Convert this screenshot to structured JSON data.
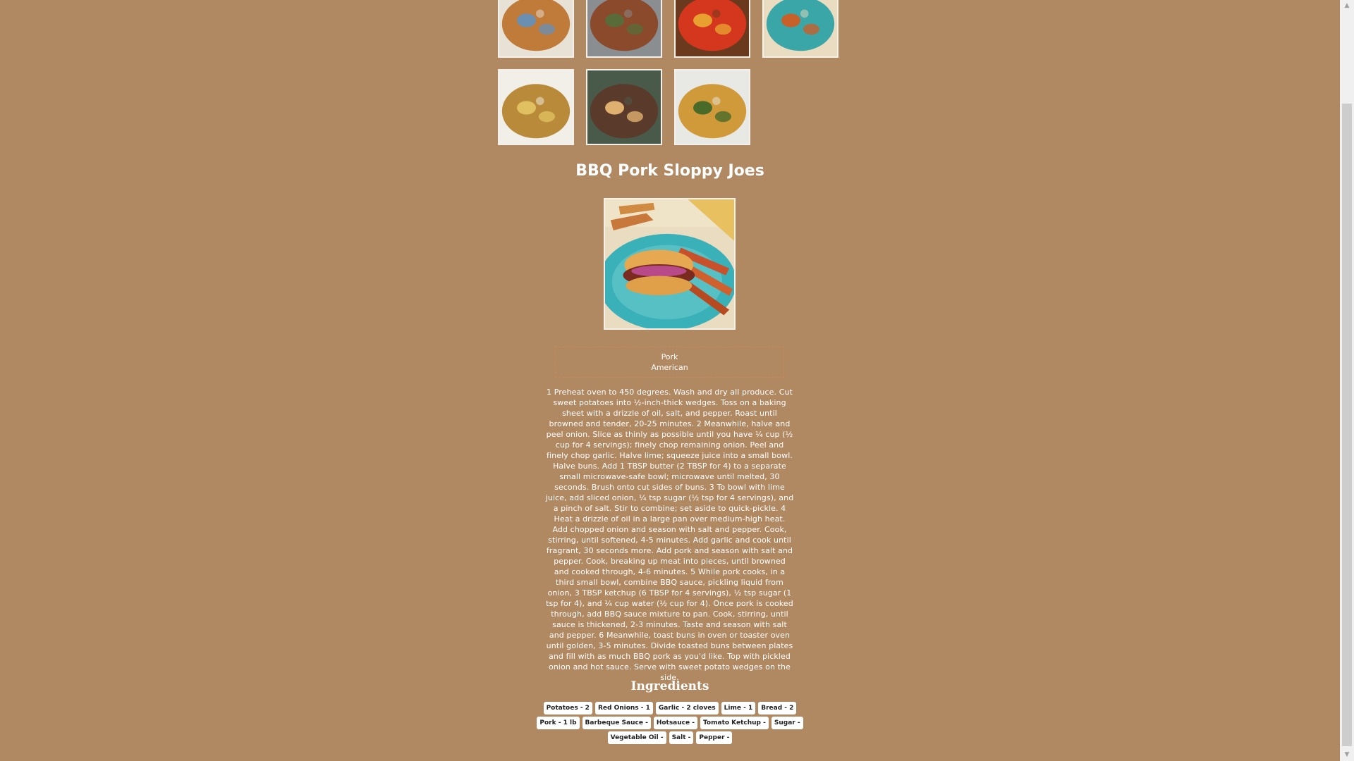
{
  "recipe": {
    "title": "BBQ Pork Sloppy Joes",
    "protein": "Pork",
    "cuisine": "American",
    "instructions": "1 Preheat oven to 450 degrees. Wash and dry all produce. Cut sweet potatoes into ½-inch-thick wedges. Toss on a baking sheet with a drizzle of oil, salt, and pepper. Roast until browned and tender, 20-25 minutes. 2 Meanwhile, halve and peel onion. Slice as thinly as possible until you have ¼ cup (½ cup for 4 servings); finely chop remaining onion. Peel and finely chop garlic. Halve lime; squeeze juice into a small bowl. Halve buns. Add 1 TBSP butter (2 TBSP for 4) to a separate small microwave-safe bowl; microwave until melted, 30 seconds. Brush onto cut sides of buns. 3 To bowl with lime juice, add sliced onion, ¼ tsp sugar (½ tsp for 4 servings), and a pinch of salt. Stir to combine; set aside to quick-pickle. 4 Heat a drizzle of oil in a large pan over medium-high heat. Add chopped onion and season with salt and pepper. Cook, stirring, until softened, 4-5 minutes. Add garlic and cook until fragrant, 30 seconds more. Add pork and season with salt and pepper. Cook, breaking up meat into pieces, until browned and cooked through, 4-6 minutes. 5 While pork cooks, in a third small bowl, combine BBQ sauce, pickling liquid from onion, 3 TBSP ketchup (6 TBSP for 4 servings), ½ tsp sugar (1 tsp for 4), and ¼ cup water (½ cup for 4). Once pork is cooked through, add BBQ sauce mixture to pan. Cook, stirring, until sauce is thickened, 2-3 minutes. Taste and season with salt and pepper. 6 Meanwhile, toast buns in oven or toaster oven until golden, 3-5 minutes. Divide toasted buns between plates and fill with as much BBQ pork as you'd like. Top with pickled onion and hot sauce. Serve with sweet potato wedges on the side.",
    "ingredients_title": "Ingredients",
    "ingredient_rows": [
      [
        "Potatoes - 2",
        "Red Onions - 1",
        "Garlic - 2 cloves",
        "Lime - 1",
        "Bread - 2"
      ],
      [
        "Pork - 1 lb",
        "Barbeque Sauce -",
        "Hotsauce -",
        "Tomato Ketchup -",
        "Sugar -"
      ],
      [
        "Vegetable Oil -",
        "Salt -",
        "Pepper -"
      ]
    ]
  },
  "thumbnails": [
    {
      "name": "thumb-chicken-cutlet-image",
      "colors": [
        "#e8e2d6",
        "#c07a3a",
        "#6b8fb0"
      ]
    },
    {
      "name": "thumb-skillet-stew-image",
      "colors": [
        "#8a8e90",
        "#8b4a2c",
        "#5a6b3a"
      ]
    },
    {
      "name": "thumb-sweet-sour-image",
      "colors": [
        "#6b3a1e",
        "#d4361e",
        "#e8a030"
      ]
    },
    {
      "name": "thumb-sloppy-joe-image",
      "colors": [
        "#e9dcc0",
        "#3aa6a8",
        "#c8602a"
      ]
    },
    {
      "name": "thumb-curry-soup-image",
      "colors": [
        "#f2efe8",
        "#b88a3a",
        "#e0c060"
      ]
    },
    {
      "name": "thumb-bibimbap-image",
      "colors": [
        "#4a5a4a",
        "#5a3a2a",
        "#e0b070"
      ]
    },
    {
      "name": "thumb-glazed-chicken-image",
      "colors": [
        "#e8e8e4",
        "#d09a3a",
        "#4a6a2a"
      ]
    }
  ]
}
